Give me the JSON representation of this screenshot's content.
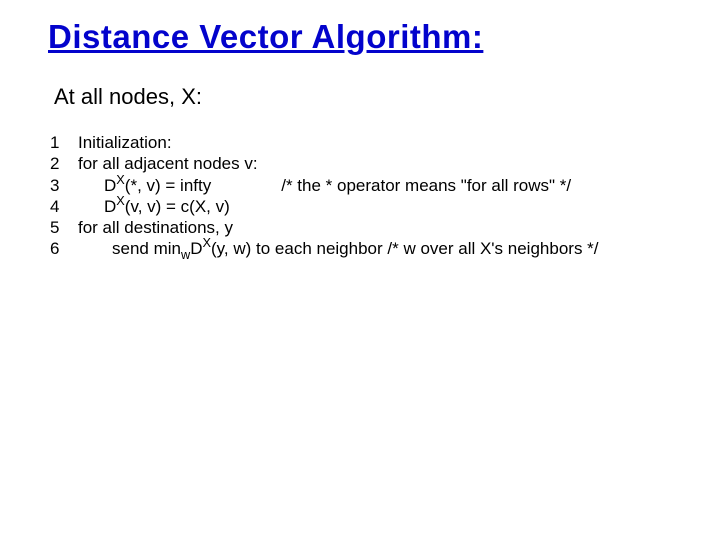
{
  "title": "Distance Vector Algorithm:",
  "subhead": "At all nodes, X:",
  "no": {
    "l1": "1",
    "l2": "2",
    "l3": "3",
    "l4": "4",
    "l5": "5",
    "l6": "6"
  },
  "l1": {
    "text": "Initialization:"
  },
  "l2": {
    "text": "for all adjacent nodes v:"
  },
  "l3": {
    "d": "D",
    "sup": "X",
    "args": "(*, v) = infty",
    "comment": "/* the * operator means \"for all rows\" */"
  },
  "l4": {
    "d": "D",
    "sup": "X",
    "rest": "(v, v) = c(X, v)"
  },
  "l5": {
    "text": "for all destinations, y"
  },
  "l6": {
    "p1": "send min",
    "sub": "w",
    "d": "D",
    "sup": "X",
    "p2": "(y, w) to each neighbor  /* w over all X's neighbors */"
  }
}
